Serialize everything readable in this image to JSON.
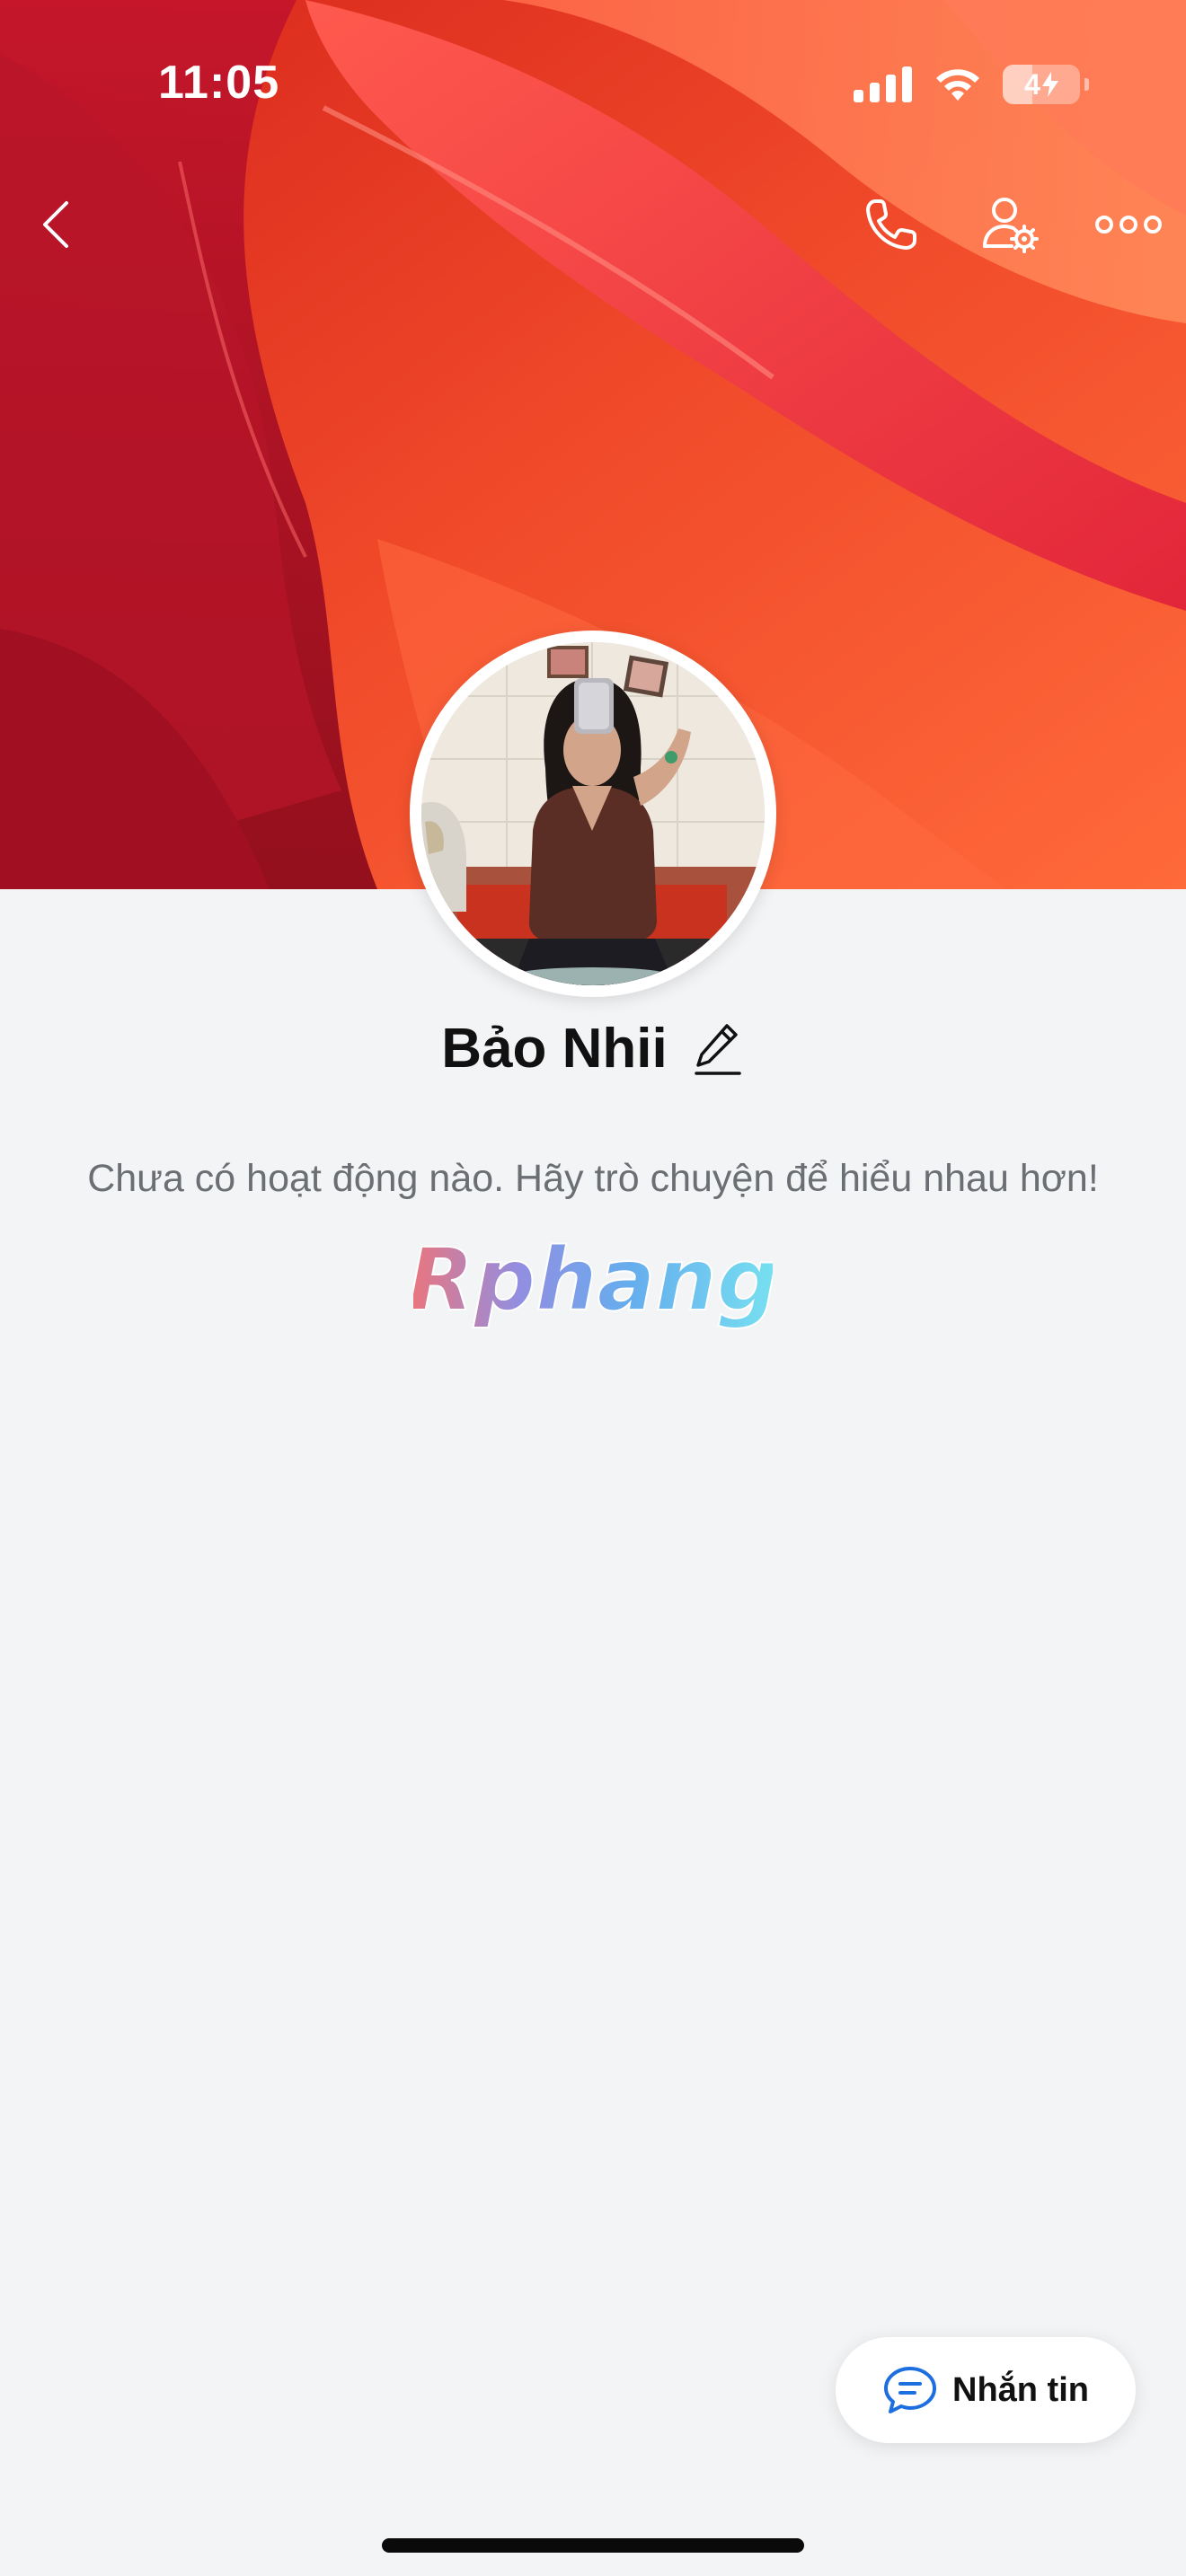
{
  "status_bar": {
    "time": "11:05",
    "battery_level": "4",
    "battery_charging": true,
    "icons": [
      "cellular-signal-icon",
      "wifi-icon",
      "battery-icon"
    ]
  },
  "header": {
    "back_icon": "chevron-left-icon",
    "actions": [
      "phone-icon",
      "user-settings-icon",
      "more-dots-icon"
    ]
  },
  "profile": {
    "name": "Bảo Nhii",
    "edit_icon": "pencil-icon",
    "empty_activity_text": "Chưa có hoạt động nào. Hãy trò chuyện để hiểu nhau hơn!",
    "watermark": "Rphang"
  },
  "actions": {
    "message_label": "Nhắn tin",
    "message_icon": "chat-bubble-icon"
  },
  "colors": {
    "background": "#f3f4f6",
    "accent_blue": "#1d6fe0",
    "cover_red": "#e0301e"
  }
}
